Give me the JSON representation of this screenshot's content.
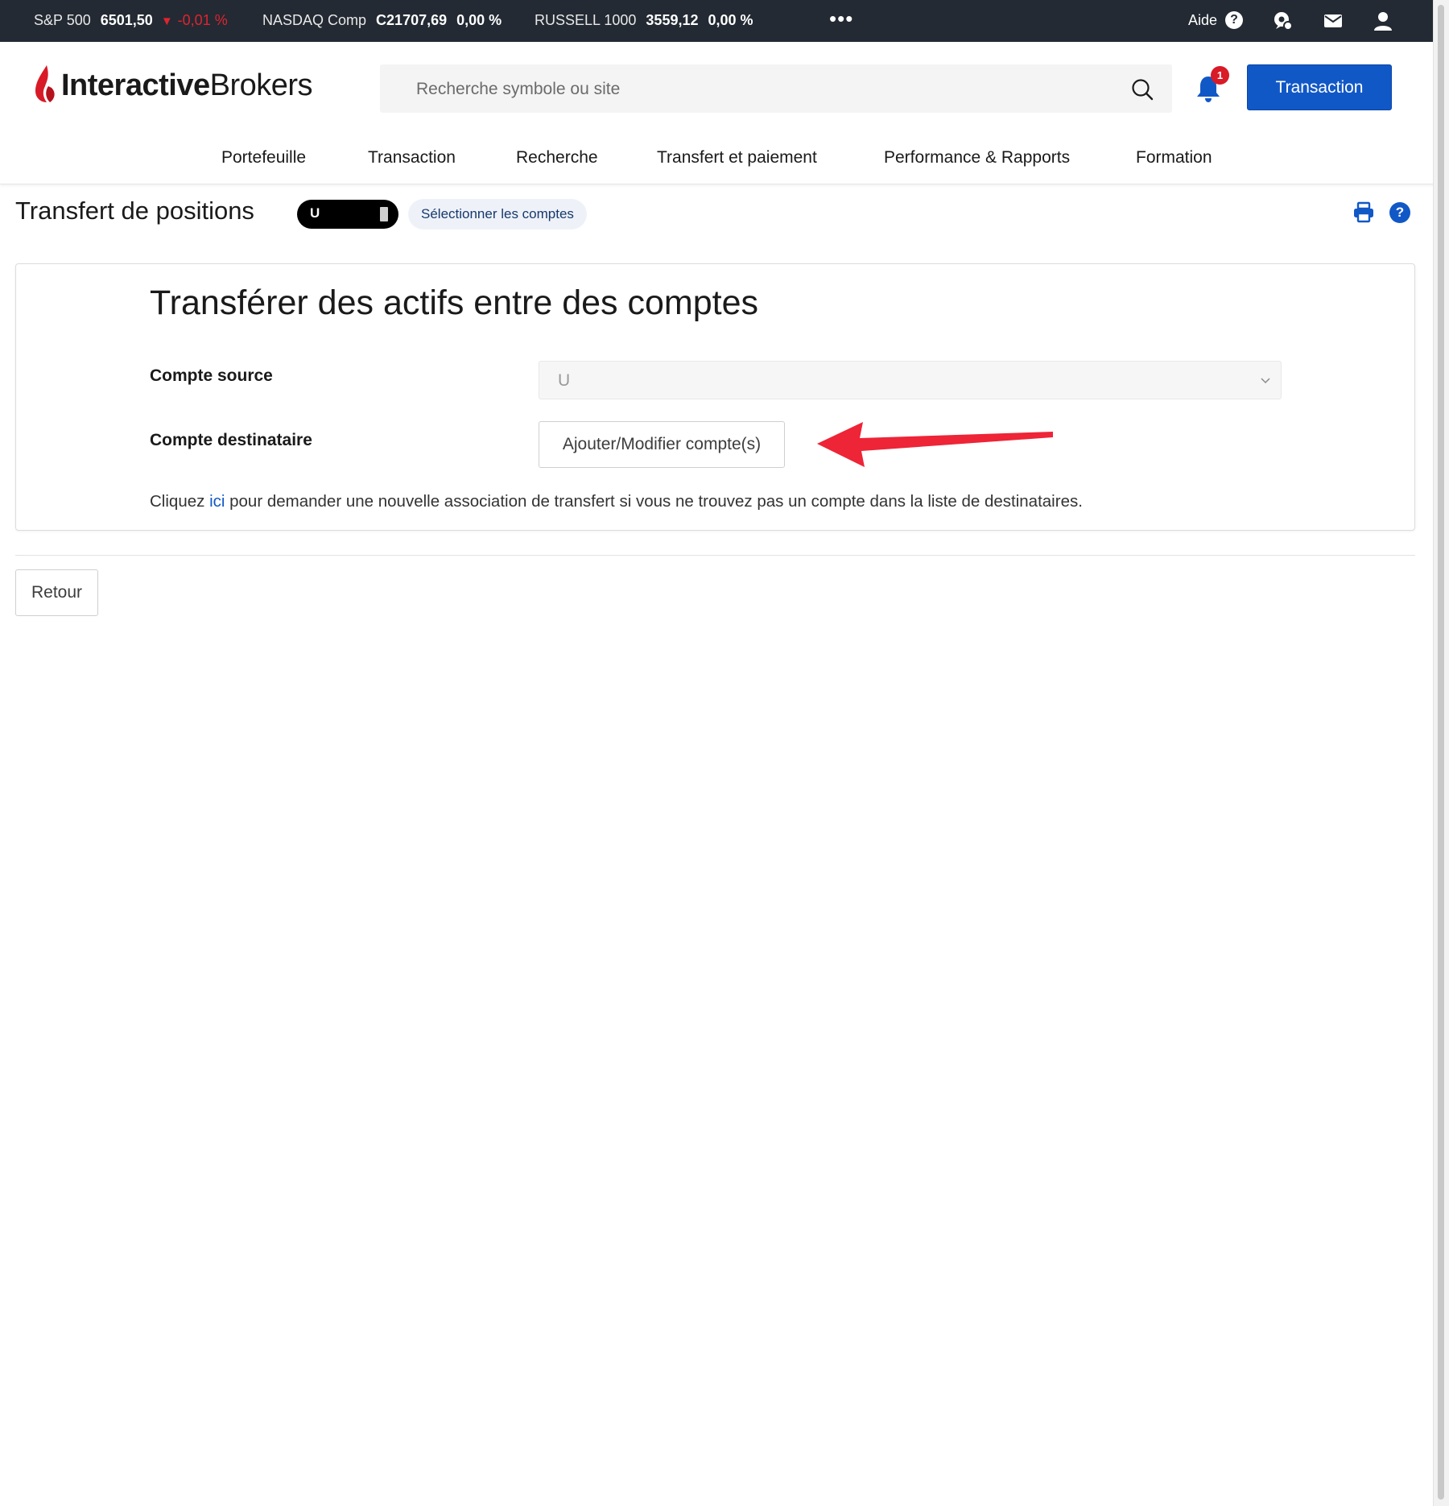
{
  "ticker": {
    "items": [
      {
        "name": "S&P 500",
        "value": "6501,50",
        "change": "-0,01 %",
        "direction": "down"
      },
      {
        "name": "NASDAQ Comp",
        "value": "C21707,69",
        "change": "0,00 %",
        "direction": "flat"
      },
      {
        "name": "RUSSELL 1000",
        "value": "3559,12",
        "change": "0,00 %",
        "direction": "flat"
      }
    ],
    "more": "•••",
    "help_label": "Aide",
    "help_glyph": "?"
  },
  "header": {
    "logo_bold": "Interactive",
    "logo_regular": "Brokers",
    "search_placeholder": "Recherche symbole ou site",
    "notification_count": "1",
    "trade_button": "Transaction"
  },
  "nav": {
    "items": [
      "Portefeuille",
      "Transaction",
      "Recherche",
      "Transfert et paiement",
      "Performance & Rapports",
      "Formation"
    ]
  },
  "page": {
    "title": "Transfert de positions",
    "account_pill": "U",
    "select_accounts": "Sélectionner les comptes",
    "help_glyph": "?"
  },
  "form": {
    "title": "Transférer des actifs entre des comptes",
    "source_label": "Compte source",
    "source_value": "U",
    "destination_label": "Compte destinataire",
    "add_modify_button": "Ajouter/Modifier compte(s)",
    "note_before": "Cliquez ",
    "note_link": "ici",
    "note_after": " pour demander une nouvelle association de transfert si vous ne trouvez pas un compte dans la liste de destinataires."
  },
  "footer": {
    "back_button": "Retour"
  },
  "colors": {
    "ticker_bg": "#232a33",
    "accent_blue": "#1158c7",
    "negative_red": "#e0242f",
    "annotation_arrow": "#ee2437",
    "logo_red": "#d81b27"
  }
}
